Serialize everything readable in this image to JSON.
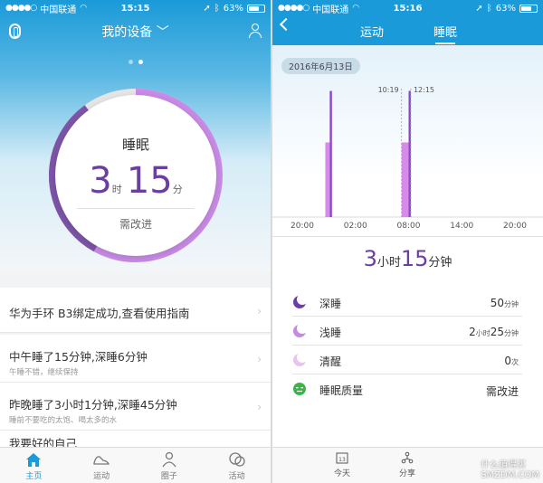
{
  "left": {
    "status": {
      "carrier": "中国联通",
      "time": "15:15",
      "battery": "63%",
      "battery_level": 0.63
    },
    "nav": {
      "title": "我的设备"
    },
    "ring": {
      "title": "睡眠",
      "hours": "3",
      "hours_unit": "时",
      "minutes": "15",
      "minutes_unit": "分",
      "status": "需改进",
      "progress": 0.9
    },
    "list": [
      {
        "title": "华为手环 B3绑定成功,查看使用指南",
        "sub": ""
      },
      {
        "title": "中午睡了15分钟,深睡6分钟",
        "sub": "午睡不错，继续保持"
      },
      {
        "title": "昨晚睡了3小时1分钟,深睡45分钟",
        "sub": "睡前不要吃的太饱、喝太多的水"
      },
      {
        "title": "我要好的自己",
        "sub": ""
      }
    ],
    "tabs": [
      "主页",
      "运动",
      "圈子",
      "活动"
    ]
  },
  "right": {
    "status": {
      "carrier": "中国联通",
      "time": "15:16",
      "battery": "63%",
      "battery_level": 0.63
    },
    "nav": {
      "tab_run": "运动",
      "tab_sleep": "睡眠"
    },
    "date": "2016年6月13日",
    "chart_data": {
      "type": "bar",
      "x_ticks": [
        "20:00",
        "02:00",
        "08:00",
        "14:00",
        "20:00"
      ],
      "annotations": [
        "10:19",
        "12:15"
      ],
      "series": [
        {
          "kind": "light",
          "color": "#d88ae8",
          "segments": [
            [
              2.6,
              3.1
            ],
            [
              11.2,
              12.0
            ]
          ]
        },
        {
          "kind": "deep",
          "color": "#8a49c8",
          "segments": [
            [
              3.1,
              3.35
            ],
            [
              12.0,
              12.25
            ]
          ]
        }
      ],
      "y_levels": {
        "light": 0.55,
        "deep": 0.93
      }
    },
    "summary": {
      "hours": "3",
      "hours_unit": "小时",
      "minutes": "15",
      "minutes_unit": "分钟"
    },
    "stats": [
      {
        "label": "深睡",
        "value": "50",
        "unit": "分钟"
      },
      {
        "label": "浅睡",
        "value": "2",
        "unit": "小时",
        "value2": "25",
        "unit2": "分钟"
      },
      {
        "label": "清醒",
        "value": "0",
        "unit": "次"
      },
      {
        "label": "睡眠质量",
        "value": "需改进",
        "unit": ""
      }
    ],
    "tabs": [
      "今天",
      "分享"
    ],
    "calendar_day": "13",
    "watermark": "什么值得买",
    "watermark_sub": "SMZDM.COM"
  }
}
